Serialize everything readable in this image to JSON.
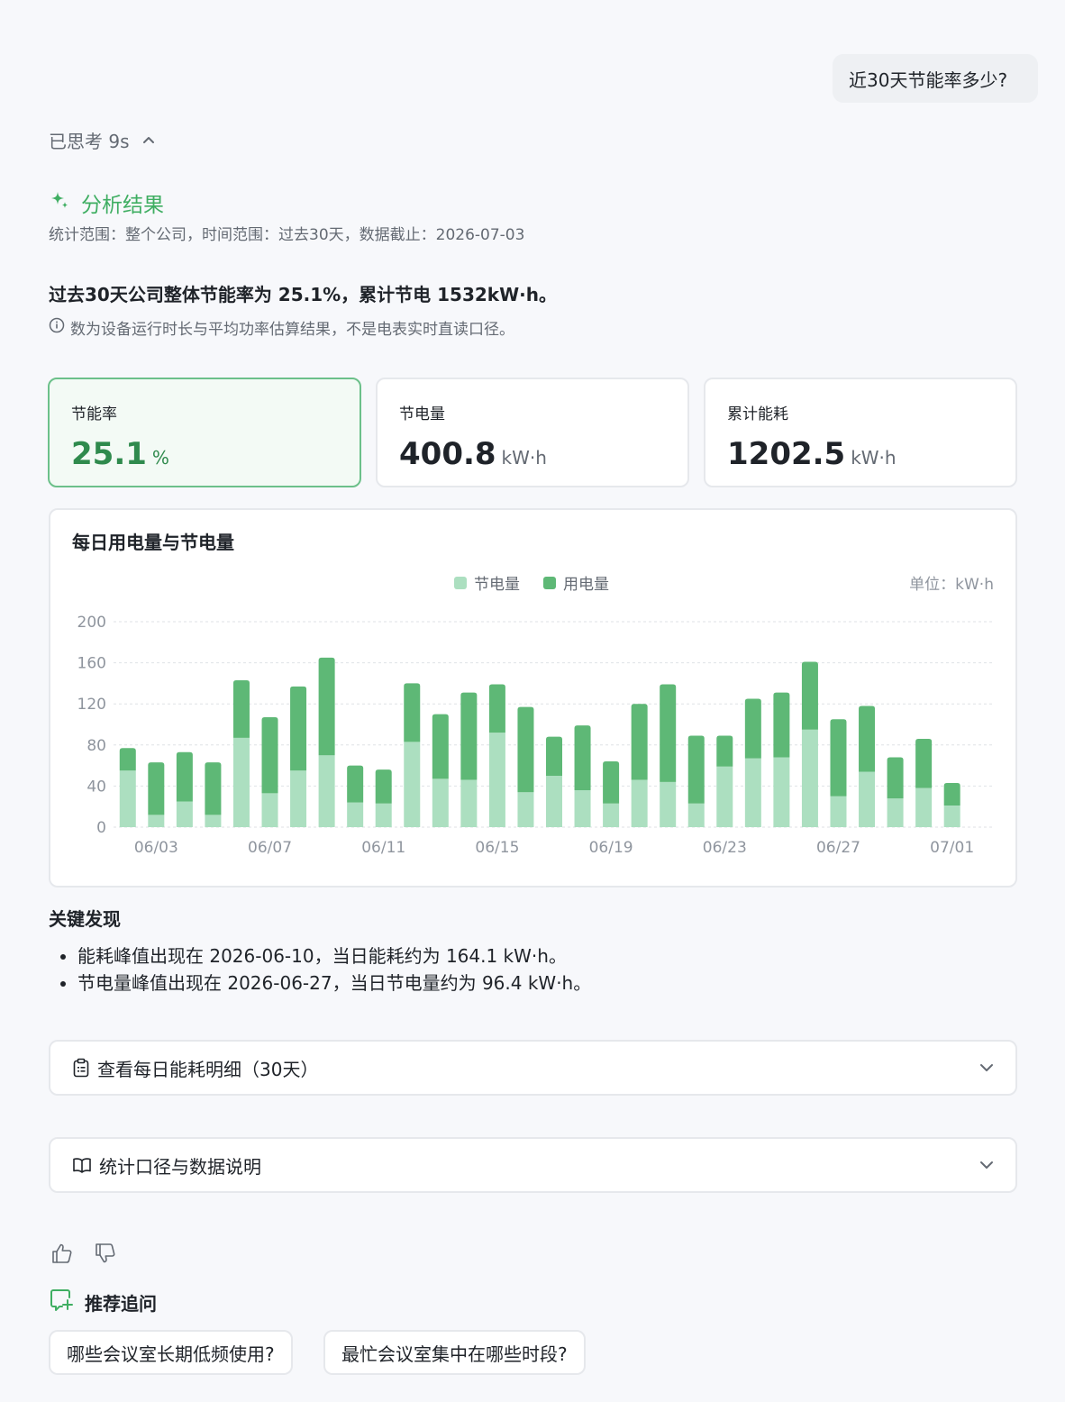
{
  "user_message": "近30天节能率多少?",
  "thinking": {
    "label": "已思考 9s"
  },
  "analysis": {
    "title": "分析结果",
    "meta": "统计范围：整个公司，时间范围：过去30天，数据截止：2026-07-03",
    "summary": "过去30天公司整体节能率为 25.1%，累计节电 1532kW·h。",
    "note": "数为设备运行时长与平均功率估算结果，不是电表实时直读口径。"
  },
  "kpis": [
    {
      "label": "节能率",
      "value": "25.1",
      "unit": "%"
    },
    {
      "label": "节电量",
      "value": "400.8",
      "unit": "kW·h"
    },
    {
      "label": "累计能耗",
      "value": "1202.5",
      "unit": "kW·h"
    }
  ],
  "chart_data": {
    "type": "bar",
    "stacked": true,
    "title": "每日用电量与节电量",
    "unit_label": "单位：kW·h",
    "legend_position": "top-center",
    "ylim": [
      0,
      200
    ],
    "yticks": [
      "0",
      "40",
      "80",
      "120",
      "160",
      "200"
    ],
    "xtick_labels": [
      "06/03",
      "06/07",
      "06/11",
      "06/15",
      "06/19",
      "06/23",
      "06/27",
      "07/01"
    ],
    "xtick_index": [
      1,
      5,
      9,
      13,
      17,
      21,
      25,
      29
    ],
    "categories": [
      "06/02",
      "06/03",
      "06/04",
      "06/05",
      "06/06",
      "06/07",
      "06/08",
      "06/09",
      "06/10",
      "06/11",
      "06/12",
      "06/13",
      "06/14",
      "06/15",
      "06/16",
      "06/17",
      "06/18",
      "06/19",
      "06/20",
      "06/21",
      "06/22",
      "06/23",
      "06/24",
      "06/25",
      "06/26",
      "06/27",
      "06/28",
      "06/29",
      "06/30",
      "07/01",
      "07/02"
    ],
    "series": [
      {
        "name": "节电量",
        "color": "#acdfc0",
        "values": [
          55,
          12,
          25,
          12,
          87,
          33,
          55,
          70,
          24,
          23,
          83,
          47,
          46,
          92,
          34,
          50,
          36,
          23,
          46,
          44,
          23,
          59,
          67,
          68,
          95,
          30,
          54,
          28,
          38,
          21,
          0
        ]
      },
      {
        "name": "用电量",
        "color": "#5eb876",
        "values": [
          22,
          51,
          48,
          51,
          56,
          74,
          82,
          95,
          36,
          33,
          57,
          63,
          85,
          47,
          83,
          38,
          63,
          41,
          74,
          95,
          66,
          30,
          58,
          63,
          66,
          75,
          64,
          40,
          48,
          22,
          0
        ]
      }
    ]
  },
  "findings": {
    "title": "关键发现",
    "items": [
      "能耗峰值出现在 2026-06-10，当日能耗约为 164.1 kW·h。",
      "节电量峰值出现在 2026-06-27，当日节电量约为 96.4 kW·h。"
    ]
  },
  "collapsibles": [
    {
      "label": "查看每日能耗明细（30天）"
    },
    {
      "label": "统计口径与数据说明"
    }
  ],
  "recommend": {
    "title": "推荐追问",
    "chips": [
      "哪些会议室长期低频使用?",
      "最忙会议室集中在哪些时段?"
    ]
  },
  "colors": {
    "accent": "#3fae62",
    "accent_dark": "#2f8a4d",
    "saved": "#acdfc0",
    "used": "#5eb876"
  }
}
